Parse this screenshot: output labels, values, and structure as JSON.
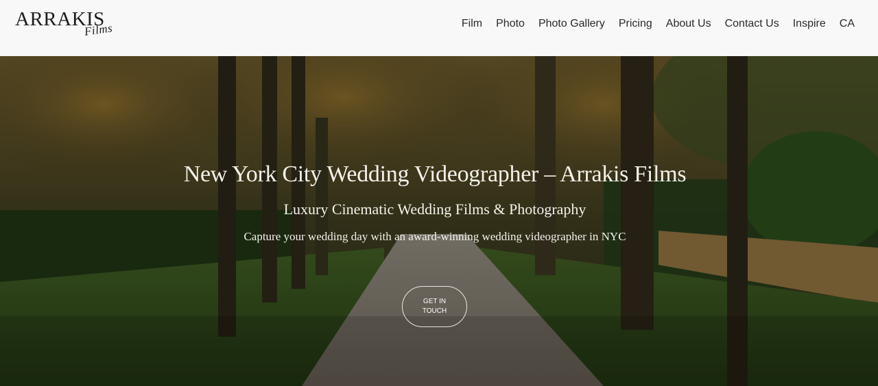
{
  "brand": {
    "logo_main": "ARRAKIS",
    "logo_sub": "Films"
  },
  "nav": {
    "items": [
      {
        "label": "Film"
      },
      {
        "label": "Photo"
      },
      {
        "label": "Photo Gallery"
      },
      {
        "label": "Pricing"
      },
      {
        "label": "About Us"
      },
      {
        "label": "Contact Us"
      },
      {
        "label": "Inspire"
      },
      {
        "label": "CA"
      }
    ]
  },
  "hero": {
    "title": "New York City Wedding Videographer – Arrakis Films",
    "subtitle": "Luxury Cinematic Wedding Films & Photography",
    "tagline": "Capture your wedding day with an award-winning wedding videographer in NYC",
    "cta_label": "GET IN TOUCH",
    "image": "tree-lined-path-photo"
  },
  "colors": {
    "header_bg": "#f8f8f8",
    "nav_text": "#2a2a2a",
    "hero_text": "#f4f1ea"
  }
}
